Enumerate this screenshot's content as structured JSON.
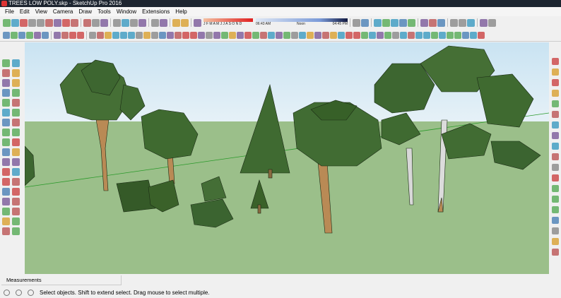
{
  "window": {
    "title": "TREES LOW POLY.skp - SketchUp Pro 2016"
  },
  "menu": [
    "File",
    "Edit",
    "View",
    "Camera",
    "Draw",
    "Tools",
    "Window",
    "Extensions",
    "Help"
  ],
  "shadow": {
    "months": "J F M A M J J A S O N D",
    "time_start": "06:43 AM",
    "time_mid": "Noon",
    "time_end": "04:45 PM"
  },
  "toolbar1": [
    "select-icon",
    "make-component-icon",
    "eraser-icon",
    "paint-bucket-icon",
    "wireframe-icon",
    "hidden-line-icon",
    "shaded-icon",
    "shaded-textures-icon",
    "monochrome-icon",
    "|",
    "3d-warehouse-icon",
    "open-icon",
    "save-icon",
    "|",
    "cut-icon",
    "copy-icon",
    "paste-icon",
    "erase-icon",
    "|",
    "undo-icon",
    "redo-icon",
    "|",
    "print-icon",
    "model-info-icon",
    "|",
    "shadow-toggle-icon"
  ],
  "toolbar1_right": [
    "orbit-icon",
    "iso-view-icon",
    "|",
    "top-view-icon",
    "front-view-icon",
    "right-view-icon",
    "back-view-icon",
    "left-view-icon",
    "|",
    "section-plane-icon",
    "xray-icon",
    "back-edges-icon",
    "|",
    "camera-icon",
    "look-around-icon",
    "walk-icon",
    "|",
    "layer-icon",
    "sandbox-icon"
  ],
  "toolbar2": [
    "iso-icon",
    "top-icon",
    "front-icon",
    "right-icon",
    "back-icon",
    "left-icon",
    "|",
    "extension-warehouse-icon",
    "components-icon",
    "materials-icon",
    "styles-icon",
    "|",
    "follow-me-icon",
    "arc-icon",
    "paint-icon",
    "line-icon",
    "rectangle-icon",
    "circle-icon",
    "polygon-icon",
    "offset-icon",
    "push-pull-icon",
    "move-icon",
    "rotate-icon",
    "scale-icon",
    "tape-measure-icon",
    "dimension-icon",
    "protractor-icon",
    "text-icon",
    "axes-icon",
    "3d-text-icon",
    "orbit-icon",
    "pan-icon",
    "zoom-icon",
    "zoom-window-icon",
    "zoom-extents-icon",
    "previous-icon",
    "next-icon",
    "position-camera-icon",
    "look-around-icon",
    "walk-icon",
    "section-icon",
    "sandbox-from-contours-icon",
    "sandbox-from-scratch-icon",
    "smoove-icon",
    "stamp-icon",
    "drape-icon",
    "add-detail-icon",
    "flip-edge-icon",
    "intersect-icon",
    "union-icon",
    "subtract-icon",
    "trim-icon",
    "split-icon",
    "outer-shell-icon",
    "solid-inspector-icon",
    "geo-location-icon",
    "photo-textures-icon",
    "upload-icon",
    "download-icon",
    "share-icon",
    "generate-report-icon",
    "dynamic-components-icon",
    "attributes-icon"
  ],
  "leftbar": [
    "select-icon",
    "make-component-icon",
    "paint-bucket-icon",
    "eraser-icon",
    "line-icon",
    "freehand-icon",
    "rectangle-icon",
    "rotated-rectangle-icon",
    "circle-icon",
    "polygon-icon",
    "arc-icon",
    "two-point-arc-icon",
    "three-point-arc-icon",
    "pie-icon",
    "move-icon",
    "push-pull-icon",
    "rotate-icon",
    "follow-me-icon",
    "scale-icon",
    "offset-icon",
    "tape-measure-icon",
    "dimension-icon",
    "protractor-icon",
    "text-icon",
    "axes-icon",
    "3d-text-icon",
    "orbit-icon",
    "pan-icon",
    "zoom-icon",
    "zoom-window-icon",
    "zoom-extents-icon",
    "previous-view-icon",
    "position-camera-icon",
    "look-around-icon",
    "walk-icon",
    "section-plane-icon"
  ],
  "rightbar": [
    "geo-location-icon",
    "add-location-icon",
    "toggle-terrain-icon",
    "photo-textures-icon",
    "get-models-icon",
    "share-model-icon",
    "share-component-icon",
    "extension-warehouse-icon",
    "extension-manager-icon",
    "trimble-connect-icon",
    "sandbox-icon",
    "solid-tools-icon",
    "dynamic-components-icon",
    "advanced-camera-icon",
    "ruby-console-icon",
    "layout-icon",
    "style-builder-icon",
    "help-icon",
    "info-icon"
  ],
  "measurements": {
    "label": "Measurements"
  },
  "status": {
    "message": "Select objects. Shift to extend select. Drag mouse to select multiple."
  }
}
